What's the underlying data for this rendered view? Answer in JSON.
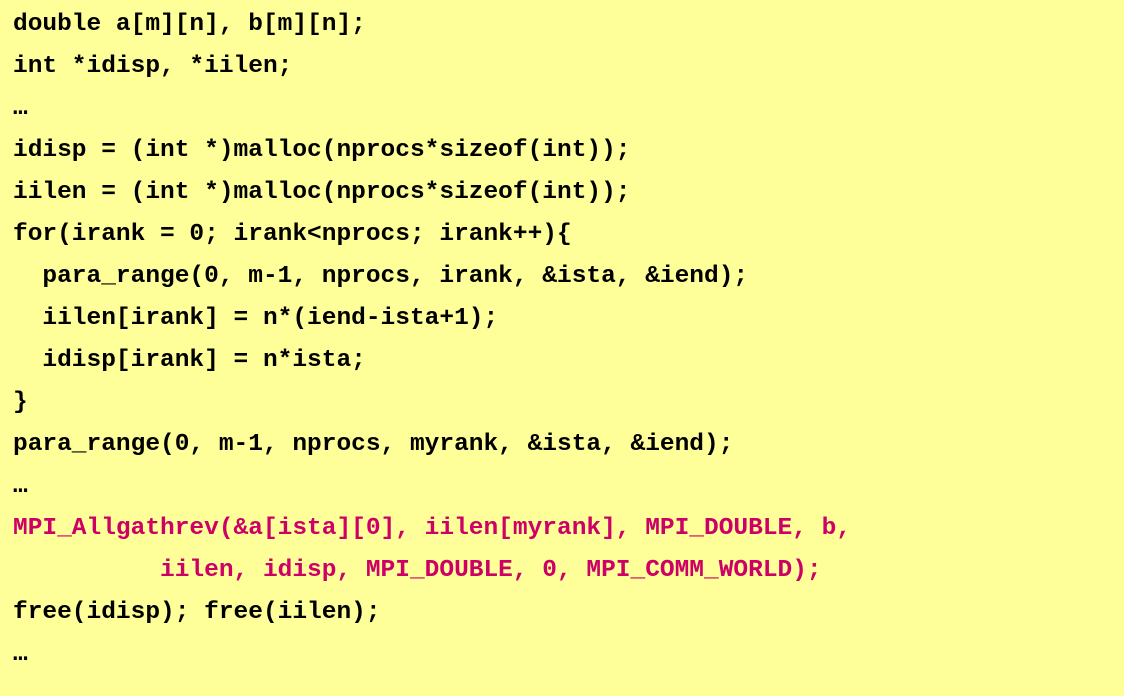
{
  "code": {
    "lines": [
      {
        "text": "double a[m][n], b[m][n];",
        "highlight": false
      },
      {
        "text": "int *idisp, *iilen;",
        "highlight": false
      },
      {
        "text": "…",
        "highlight": false
      },
      {
        "text": "idisp = (int *)malloc(nprocs*sizeof(int));",
        "highlight": false
      },
      {
        "text": "iilen = (int *)malloc(nprocs*sizeof(int));",
        "highlight": false
      },
      {
        "text": "for(irank = 0; irank<nprocs; irank++){",
        "highlight": false
      },
      {
        "text": "  para_range(0, m-1, nprocs, irank, &ista, &iend);",
        "highlight": false
      },
      {
        "text": "  iilen[irank] = n*(iend-ista+1);",
        "highlight": false
      },
      {
        "text": "  idisp[irank] = n*ista;",
        "highlight": false
      },
      {
        "text": "}",
        "highlight": false
      },
      {
        "text": "para_range(0, m-1, nprocs, myrank, &ista, &iend);",
        "highlight": false
      },
      {
        "text": "…",
        "highlight": false
      },
      {
        "text": "MPI_Allgathrev(&a[ista][0], iilen[myrank], MPI_DOUBLE, b,",
        "highlight": true
      },
      {
        "text": "          iilen, idisp, MPI_DOUBLE, 0, MPI_COMM_WORLD);",
        "highlight": true
      },
      {
        "text": "free(idisp); free(iilen);",
        "highlight": false
      },
      {
        "text": "…",
        "highlight": false
      }
    ]
  },
  "colors": {
    "background": "#ffff99",
    "text": "#000000",
    "highlight": "#cc0066"
  }
}
